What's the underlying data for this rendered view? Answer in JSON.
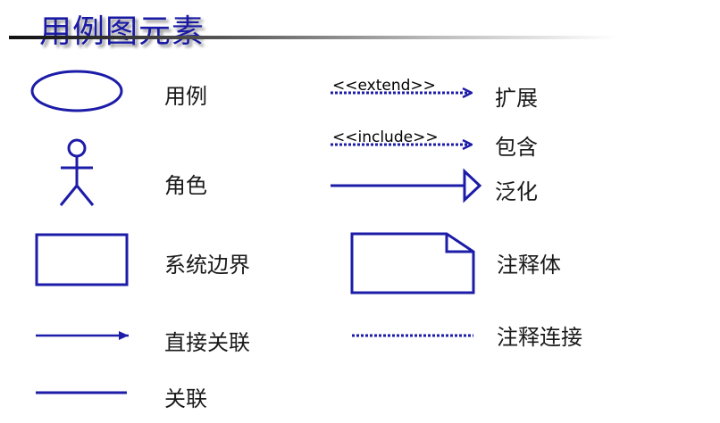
{
  "title": "用例图元素",
  "colors": {
    "stroke": "#1c1ca8",
    "title": "#1a1aa6"
  },
  "elements": [
    {
      "label": "用例",
      "icon": "ellipse-icon"
    },
    {
      "label": "角色",
      "icon": "stick-figure-icon"
    },
    {
      "label": "系统边界",
      "icon": "rectangle-icon"
    },
    {
      "label": "直接关联",
      "icon": "arrow-line-icon"
    },
    {
      "label": "关联",
      "icon": "solid-line-icon"
    },
    {
      "label": "扩展",
      "stereotype": "<<extend>>",
      "icon": "dashed-arrow-icon"
    },
    {
      "label": "包含",
      "stereotype": "<<include>>",
      "icon": "dashed-arrow-icon"
    },
    {
      "label": "泛化",
      "icon": "hollow-triangle-arrow-icon"
    },
    {
      "label": "注释体",
      "icon": "note-icon"
    },
    {
      "label": "注释连接",
      "icon": "dotted-line-icon"
    }
  ]
}
